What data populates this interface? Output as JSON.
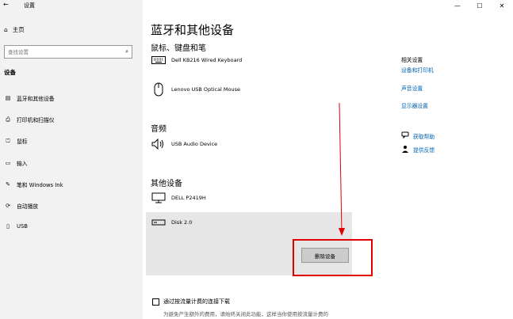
{
  "window": {
    "title": "设置",
    "back_glyph": "←",
    "controls": {
      "minimize": "—",
      "maximize": "☐",
      "close": "✕"
    }
  },
  "sidebar": {
    "home_icon": "⌂",
    "home_label": "主页",
    "search_placeholder": "查找设置",
    "search_icon": "⌕",
    "section_label": "设备",
    "items": [
      {
        "icon": "▤",
        "label": "蓝牙和其他设备"
      },
      {
        "icon": "⎙",
        "label": "打印机和扫描仪"
      },
      {
        "icon": "⏍",
        "label": "鼠标"
      },
      {
        "icon": "▭",
        "label": "输入"
      },
      {
        "icon": "✎",
        "label": "笔和 Windows Ink"
      },
      {
        "icon": "⟳",
        "label": "自动播放"
      },
      {
        "icon": "▯",
        "label": "USB"
      }
    ]
  },
  "main": {
    "title": "蓝牙和其他设备",
    "mouse_section": "鼠标、键盘和笔",
    "keyboard_name": "Dell KB216 Wired Keyboard",
    "mouse_name": "Lenovo USB Optical Mouse",
    "audio_section": "音频",
    "audio_device": "USB Audio Device",
    "other_section": "其他设备",
    "monitor_name": "DELL P2419H",
    "disk_name": "Disk 2.0",
    "remove_button": "删除设备",
    "metered_checkbox": "通过按流量计费的连接下载",
    "metered_note": "为避免产生额外的费用，请始终关闭此功能，这样当你使用按流量计费的"
  },
  "right_panel": {
    "related_title": "相关设置",
    "links": [
      "设备和打印机",
      "声音设置",
      "显示器设置"
    ],
    "help_label": "获取帮助",
    "feedback_label": "提供反馈"
  },
  "colors": {
    "annotation_red": "#e00000",
    "link_blue": "#0063b1"
  }
}
